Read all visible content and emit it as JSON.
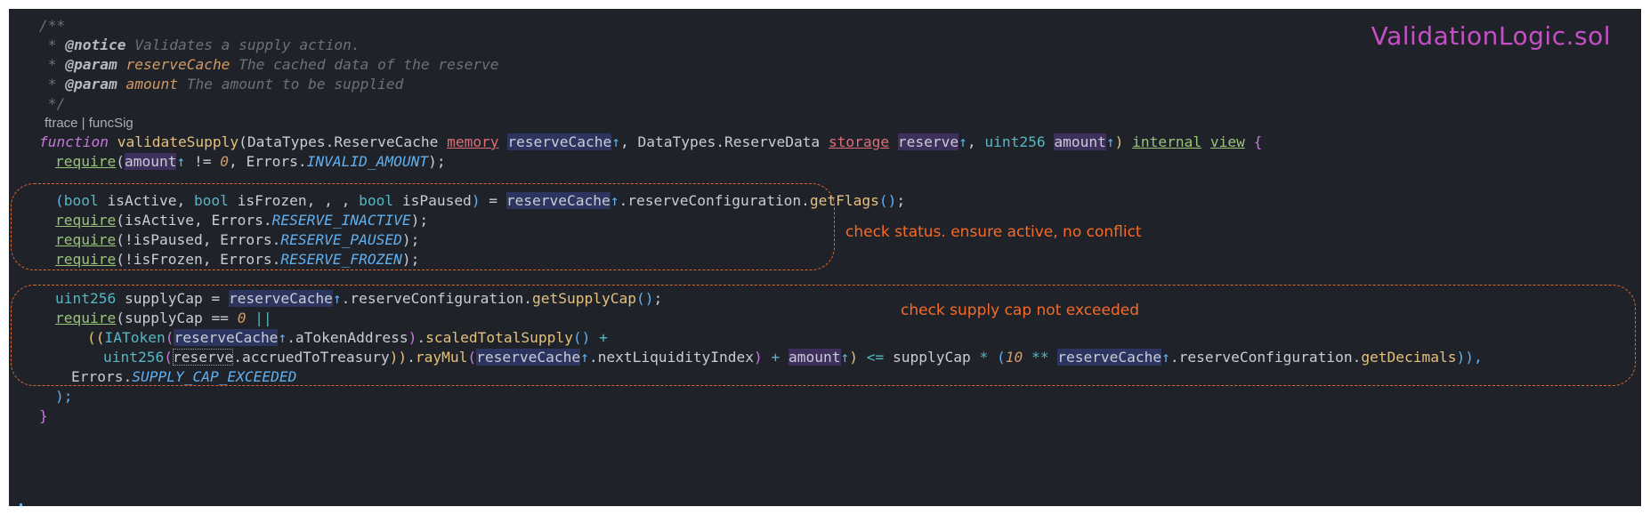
{
  "file_title": "ValidationLogic.sol",
  "codelens": "ftrace | funcSig",
  "annotations": {
    "status": "check status. ensure active, no conflict",
    "supply": "check supply cap not exceeded"
  },
  "doc": {
    "open": "/**",
    "star": " * ",
    "notice_tag": "@notice",
    "notice_text": " Validates a supply action.",
    "param_tag": "@param",
    "param1_name": "reserveCache",
    "param1_text": " The cached data of the reserve",
    "param2_name": "amount",
    "param2_text": " The amount to be supplied",
    "close": " */"
  },
  "sig": {
    "kw_function": "function",
    "fname": "validateSupply",
    "p_open": "(",
    "type1": "DataTypes.ReserveCache",
    "memory": "memory",
    "var1": "reserveCache",
    "arrow": "↑",
    "comma": ", ",
    "type2": "DataTypes.ReserveData",
    "storage": "storage",
    "var2": "reserve",
    "uint256": "uint256",
    "var3": "amount",
    "p_close": ")",
    "internal": "internal",
    "view": "view",
    "brace_open": "{"
  },
  "code": {
    "require": "require",
    "l1_open": "(",
    "amount": "amount",
    "l1_rest": " != ",
    "zero": "0",
    "l1_err": ", Errors.",
    "invalid_amount": "INVALID_AMOUNT",
    "close_semi": ");",
    "flags_open": "(",
    "bool": "bool",
    "isActive_decl": " isActive, ",
    "isFrozen_decl": " isFrozen, , , ",
    "isPaused_decl": " isPaused",
    "flags_close": ")",
    "assign": " = ",
    "reserveCache": "reserveCache",
    "reserve": "reserve",
    "arrow": "↑",
    "dot_reserveConfiguration": ".reserveConfiguration.",
    "getFlags": "getFlags",
    "empty_call": "()",
    "semi": ";",
    "open": "(",
    "req_active_args": "isActive, Errors.",
    "reserve_inactive": "RESERVE_INACTIVE",
    "req_paused_args": "!isPaused, Errors.",
    "reserve_paused": "RESERVE_PAUSED",
    "req_frozen_args": "!isFrozen, Errors.",
    "reserve_frozen": "RESERVE_FROZEN",
    "uint256": "uint256",
    "supplyCap_decl": " supplyCap = ",
    "getSupplyCap": "getSupplyCap",
    "supplyCap_cmp": "supplyCap == ",
    "or": "||",
    "double_open": "((",
    "IAToken": "IAToken",
    "dot_aTokenAddress": ".aTokenAddress",
    "close_paren": ")",
    "dot": ".",
    "scaledTotalSupply": "scaledTotalSupply",
    "plus": "+",
    "dot_accruedToTreasury": ".accruedToTreasury",
    "double_close": "))",
    "rayMul": "rayMul",
    "dot_nextLiquidityIndex": ".nextLiquidityIndex",
    "lte": "<=",
    "supplyCap_mul": " supplyCap ",
    "star": "*",
    "ten": "10",
    "pow": "**",
    "getDecimals": "getDecimals",
    "triple_close_comma": ")),",
    "errors": "Errors.",
    "supply_cap_exceeded": "SUPPLY_CAP_EXCEEDED",
    "closing_paren": ");",
    "closing_brace": "}"
  }
}
